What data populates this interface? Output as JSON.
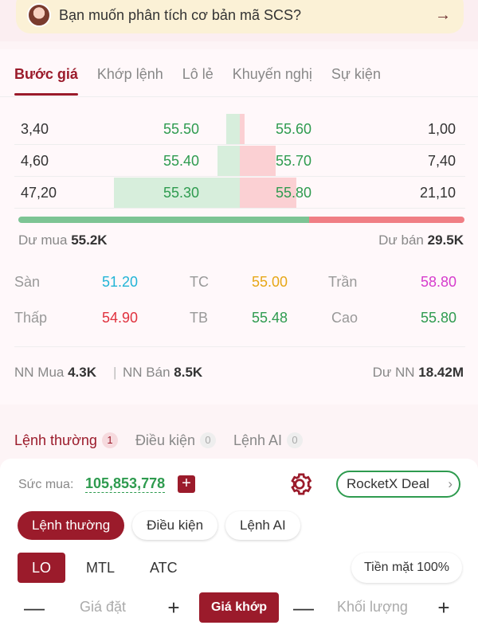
{
  "assistant": {
    "question": "Bạn muốn phân tích cơ bản mã SCS?"
  },
  "tabs": [
    "Bước giá",
    "Khớp lệnh",
    "Lô lẻ",
    "Khuyến nghị",
    "Sự kiện"
  ],
  "order_book": [
    {
      "bid_vol": "3,40",
      "bid_price": "55.50",
      "ask_price": "55.60",
      "ask_vol": "1,00",
      "bid_fill": 0.06,
      "ask_fill": 0.02
    },
    {
      "bid_vol": "4,60",
      "bid_price": "55.40",
      "ask_price": "55.70",
      "ask_vol": "7,40",
      "bid_fill": 0.1,
      "ask_fill": 0.16
    },
    {
      "bid_vol": "47,20",
      "bid_price": "55.30",
      "ask_price": "55.80",
      "ask_vol": "21,10",
      "bid_fill": 0.56,
      "ask_fill": 0.25
    }
  ],
  "balance": {
    "buy_ratio": 0.652,
    "du_mua_label": "Dư mua",
    "du_mua": "55.2K",
    "du_ban_label": "Dư bán",
    "du_ban": "29.5K"
  },
  "stats": {
    "san_label": "Sàn",
    "san": "51.20",
    "tc_label": "TC",
    "tc": "55.00",
    "tran_label": "Trần",
    "tran": "58.80",
    "thap_label": "Thấp",
    "thap": "54.90",
    "tb_label": "TB",
    "tb": "55.48",
    "cao_label": "Cao",
    "cao": "55.80"
  },
  "foreign": {
    "mua_label": "NN Mua",
    "mua": "4.3K",
    "sep": "|",
    "ban_label": "NN Bán",
    "ban": "8.5K",
    "du_label": "Dư NN",
    "du": "18.42M"
  },
  "order_tabs": [
    {
      "label": "Lệnh thường",
      "count": "1"
    },
    {
      "label": "Điều kiện",
      "count": "0"
    },
    {
      "label": "Lệnh AI",
      "count": "0"
    }
  ],
  "form": {
    "suc_mua_label": "Sức mua:",
    "suc_mua": "105,853,778",
    "plus": "+",
    "rocket": "RocketX Deal",
    "rocket_chev": "›",
    "pills": [
      "Lệnh thường",
      "Điều kiện",
      "Lệnh AI"
    ],
    "types": [
      "LO",
      "MTL",
      "ATC"
    ],
    "cash": "Tiền mặt 100%",
    "minus": "—",
    "price_placeholder": "Giá đặt",
    "gia_khop": "Giá khớp",
    "qty_placeholder": "Khối lượng"
  },
  "colors": {
    "accent": "#9b1b2b",
    "up": "#2e9b4f",
    "down": "#e0323e",
    "ref": "#e6a717",
    "ceil": "#d63ccc",
    "floor": "#22b4d6"
  }
}
